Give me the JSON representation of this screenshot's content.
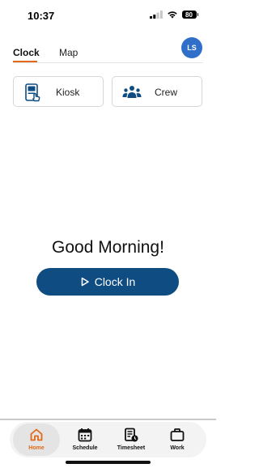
{
  "status_bar": {
    "time": "10:37",
    "battery": "80"
  },
  "avatar": {
    "initials": "LS"
  },
  "tabs": [
    {
      "label": "Clock",
      "active": true
    },
    {
      "label": "Map",
      "active": false
    }
  ],
  "actions": {
    "kiosk_label": "Kiosk",
    "crew_label": "Crew"
  },
  "greeting": "Good Morning!",
  "clock_in": {
    "label": "Clock In"
  },
  "bottom_nav": [
    {
      "label": "Home",
      "icon": "home-icon",
      "active": true
    },
    {
      "label": "Schedule",
      "icon": "calendar-icon",
      "active": false
    },
    {
      "label": "Timesheet",
      "icon": "timesheet-icon",
      "active": false
    },
    {
      "label": "Work",
      "icon": "briefcase-icon",
      "active": false
    }
  ],
  "colors": {
    "accent_orange": "#e06a1a",
    "primary_blue": "#0f4c81",
    "avatar_blue": "#2f6fc9"
  }
}
